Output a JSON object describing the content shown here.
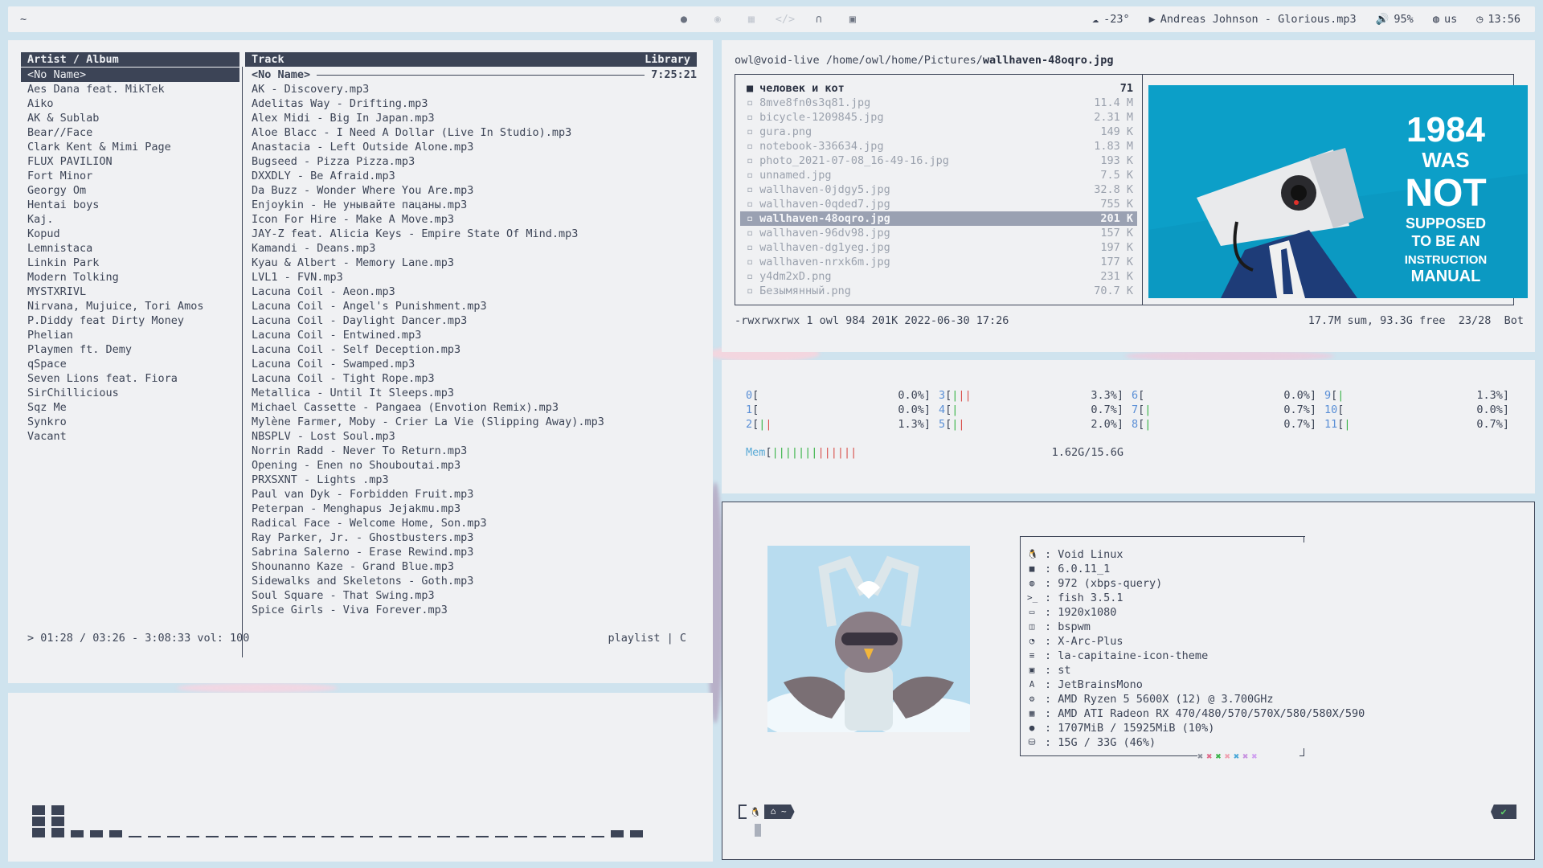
{
  "colors": {
    "panel_bg": "#f0f1f3",
    "fg": "#3c4456",
    "accent_green": "#3bb44a",
    "accent_red": "#d9534f",
    "accent_blue": "#5a8fd6",
    "preview_blue": "#0c9fc8"
  },
  "topbar": {
    "workspace": "~",
    "center_icons": [
      "firefox-icon",
      "discord-icon",
      "calendar-icon",
      "code-icon",
      "headphones-icon",
      "terminal-icon"
    ],
    "weather": "-23°",
    "now_playing": "Andreas Johnson - Glorious.mp3",
    "volume": "95%",
    "keyboard": "us",
    "clock": "13:56"
  },
  "cmus": {
    "artist_header": "Artist / Album",
    "track_header": "Track",
    "library_label": "Library",
    "artists": [
      "<No Name>",
      "Aes Dana feat. MikTek",
      "Aiko",
      "AK & Sublab",
      "Bear//Face",
      "Clark Kent & Mimi Page",
      "FLUX PAVILION",
      "Fort Minor",
      "Georgy Om",
      "Hentai boys",
      "Kaj.",
      "Kopud",
      "Lemnistaca",
      "Linkin Park",
      "Modern Tolking",
      "MYSTXRIVL",
      "Nirvana, Mujuice, Tori Amos",
      "P.Diddy feat Dirty Money",
      "Phelian",
      "Playmen ft. Demy",
      "qSpace",
      "Seven Lions feat. Fiora",
      "SirChillicious",
      "Sqz Me",
      "Synkro",
      "Vacant"
    ],
    "album_name": "<No Name>",
    "album_duration": "7:25:21",
    "tracks": [
      "AK - Discovery.mp3",
      "Adelitas Way - Drifting.mp3",
      "Alex Midi - Big In Japan.mp3",
      "Aloe Blacc - I Need A Dollar (Live In Studio).mp3",
      "Anastacia - Left Outside Alone.mp3",
      "Bugseed - Pizza Pizza.mp3",
      "DXXDLY - Be Afraid.mp3",
      "Da Buzz - Wonder Where You Are.mp3",
      "Enjoykin - Не унывайте пацаны.mp3",
      "Icon For Hire - Make A Move.mp3",
      "JAY-Z feat. Alicia Keys - Empire State Of Mind.mp3",
      "Kamandi - Deans.mp3",
      "Kyau & Albert - Memory Lane.mp3",
      "LVL1 - FVN.mp3",
      "Lacuna Coil - Aeon.mp3",
      "Lacuna Coil - Angel's Punishment.mp3",
      "Lacuna Coil - Daylight Dancer.mp3",
      "Lacuna Coil - Entwined.mp3",
      "Lacuna Coil - Self Deception.mp3",
      "Lacuna Coil - Swamped.mp3",
      "Lacuna Coil - Tight Rope.mp3",
      "Metallica - Until It Sleeps.mp3",
      "Michael Cassette - Pangaea (Envotion Remix).mp3",
      "Mylène Farmer, Moby - Crier La Vie (Slipping Away).mp3",
      "NBSPLV - Lost Soul.mp3",
      "Norrin Radd - Never To Return.mp3",
      "Opening - Enen no Shouboutai.mp3",
      "PRXSXNT - Lights .mp3",
      "Paul van Dyk - Forbidden Fruit.mp3",
      "Peterpan - Menghapus Jejakmu.mp3",
      "Radical Face - Welcome Home, Son.mp3",
      "Ray Parker, Jr. - Ghostbusters.mp3",
      "Sabrina Salerno - Erase Rewind.mp3",
      "Shounanno Kaze - Grand Blue.mp3",
      "Sidewalks and Skeletons - Goth.mp3",
      "Soul Square - That Swing.mp3",
      "Spice Girls - Viva Forever.mp3"
    ],
    "status_left": "> 01:28 / 03:26 - 3:08:33 vol: 100",
    "status_right": "playlist | C"
  },
  "visualizer": {
    "levels": [
      3,
      3,
      1,
      1,
      1,
      0,
      0,
      0,
      0,
      0,
      0,
      0,
      0,
      0,
      0,
      0,
      0,
      0,
      0,
      0,
      0,
      0,
      0,
      0,
      0,
      0,
      0,
      0,
      0,
      0,
      1,
      1
    ]
  },
  "ranger": {
    "prompt": "owl@void-live",
    "path": "/home/owl/home/Pictures/",
    "selected_file": "wallhaven-48oqro.jpg",
    "files": [
      {
        "name": "человек и кот",
        "size": "71",
        "type": "dir"
      },
      {
        "name": "8mve8fn0s3q81.jpg",
        "size": "11.4 M"
      },
      {
        "name": "bicycle-1209845.jpg",
        "size": "2.31 M"
      },
      {
        "name": "gura.png",
        "size": "149 K"
      },
      {
        "name": "notebook-336634.jpg",
        "size": "1.83 M"
      },
      {
        "name": "photo_2021-07-08_16-49-16.jpg",
        "size": "193 K"
      },
      {
        "name": "unnamed.jpg",
        "size": "7.5 K"
      },
      {
        "name": "wallhaven-0jdgy5.jpg",
        "size": "32.8 K"
      },
      {
        "name": "wallhaven-0qded7.jpg",
        "size": "755 K"
      },
      {
        "name": "wallhaven-48oqro.jpg",
        "size": "201 K",
        "selected": true
      },
      {
        "name": "wallhaven-96dv98.jpg",
        "size": "157 K"
      },
      {
        "name": "wallhaven-dg1yeg.jpg",
        "size": "197 K"
      },
      {
        "name": "wallhaven-nrxk6m.jpg",
        "size": "177 K"
      },
      {
        "name": "y4dm2xD.png",
        "size": "231 K"
      },
      {
        "name": "Безымянный.png",
        "size": "70.7 K"
      }
    ],
    "preview_text": [
      "1984",
      "WAS",
      "NOT",
      "SUPPOSED",
      "TO BE AN",
      "INSTRUCTION",
      "MANUAL"
    ],
    "footer_left": "-rwxrwxrwx 1 owl 984 201K 2022-06-30 17:26",
    "footer_right": "17.7M sum, 93.3G free  23/28  Bot"
  },
  "htop": {
    "cpus": [
      {
        "id": "0",
        "pct": "0.0%",
        "g": 0,
        "r": 0
      },
      {
        "id": "1",
        "pct": "0.0%",
        "g": 0,
        "r": 0
      },
      {
        "id": "2",
        "pct": "1.3%",
        "g": 1,
        "r": 1
      },
      {
        "id": "3",
        "pct": "3.3%",
        "g": 1,
        "r": 2
      },
      {
        "id": "4",
        "pct": "0.7%",
        "g": 1,
        "r": 0
      },
      {
        "id": "5",
        "pct": "2.0%",
        "g": 1,
        "r": 1
      },
      {
        "id": "6",
        "pct": "0.0%",
        "g": 0,
        "r": 0
      },
      {
        "id": "7",
        "pct": "0.7%",
        "g": 1,
        "r": 0
      },
      {
        "id": "8",
        "pct": "0.7%",
        "g": 1,
        "r": 0
      },
      {
        "id": "9",
        "pct": "1.3%",
        "g": 1,
        "r": 0
      },
      {
        "id": "10",
        "pct": "0.0%",
        "g": 0,
        "r": 0
      },
      {
        "id": "11",
        "pct": "0.7%",
        "g": 1,
        "r": 0
      }
    ],
    "mem_label": "Mem",
    "mem_value": "1.62G/15.6G"
  },
  "neofetch": {
    "lines": [
      {
        "icon": "linux-icon",
        "glyph": "🐧",
        "value": "Void Linux"
      },
      {
        "icon": "kernel-icon",
        "glyph": "■",
        "value": "6.0.11_1"
      },
      {
        "icon": "package-icon",
        "glyph": "◍",
        "value": "972 (xbps-query)"
      },
      {
        "icon": "shell-icon",
        "glyph": ">_",
        "value": "fish 3.5.1"
      },
      {
        "icon": "monitor-icon",
        "glyph": "▭",
        "value": "1920x1080"
      },
      {
        "icon": "window-manager-icon",
        "glyph": "◫",
        "value": "bspwm"
      },
      {
        "icon": "theme-icon",
        "glyph": "◔",
        "value": "X-Arc-Plus"
      },
      {
        "icon": "icons-icon",
        "glyph": "≡",
        "value": "la-capitaine-icon-theme"
      },
      {
        "icon": "terminal-icon",
        "glyph": "▣",
        "value": "st"
      },
      {
        "icon": "font-icon",
        "glyph": "A",
        "value": "JetBrainsMono"
      },
      {
        "icon": "cpu-icon",
        "glyph": "⚙",
        "value": "AMD Ryzen 5 5600X (12) @ 3.700GHz"
      },
      {
        "icon": "gpu-icon",
        "glyph": "▦",
        "value": "AMD ATI Radeon RX 470/480/570/570X/580/580X/590"
      },
      {
        "icon": "memory-icon",
        "glyph": "●",
        "value": "1707MiB / 15925MiB (10%)"
      },
      {
        "icon": "disk-icon",
        "glyph": "⛁",
        "value": "15G / 33G (46%)"
      }
    ],
    "dot_colors": [
      "#8a8f9a",
      "#e06b8b",
      "#3bb44a",
      "#f0a0b0",
      "#4aa8d8",
      "#c893e0",
      "#d0a0f0"
    ],
    "prompt_dir": "~"
  }
}
